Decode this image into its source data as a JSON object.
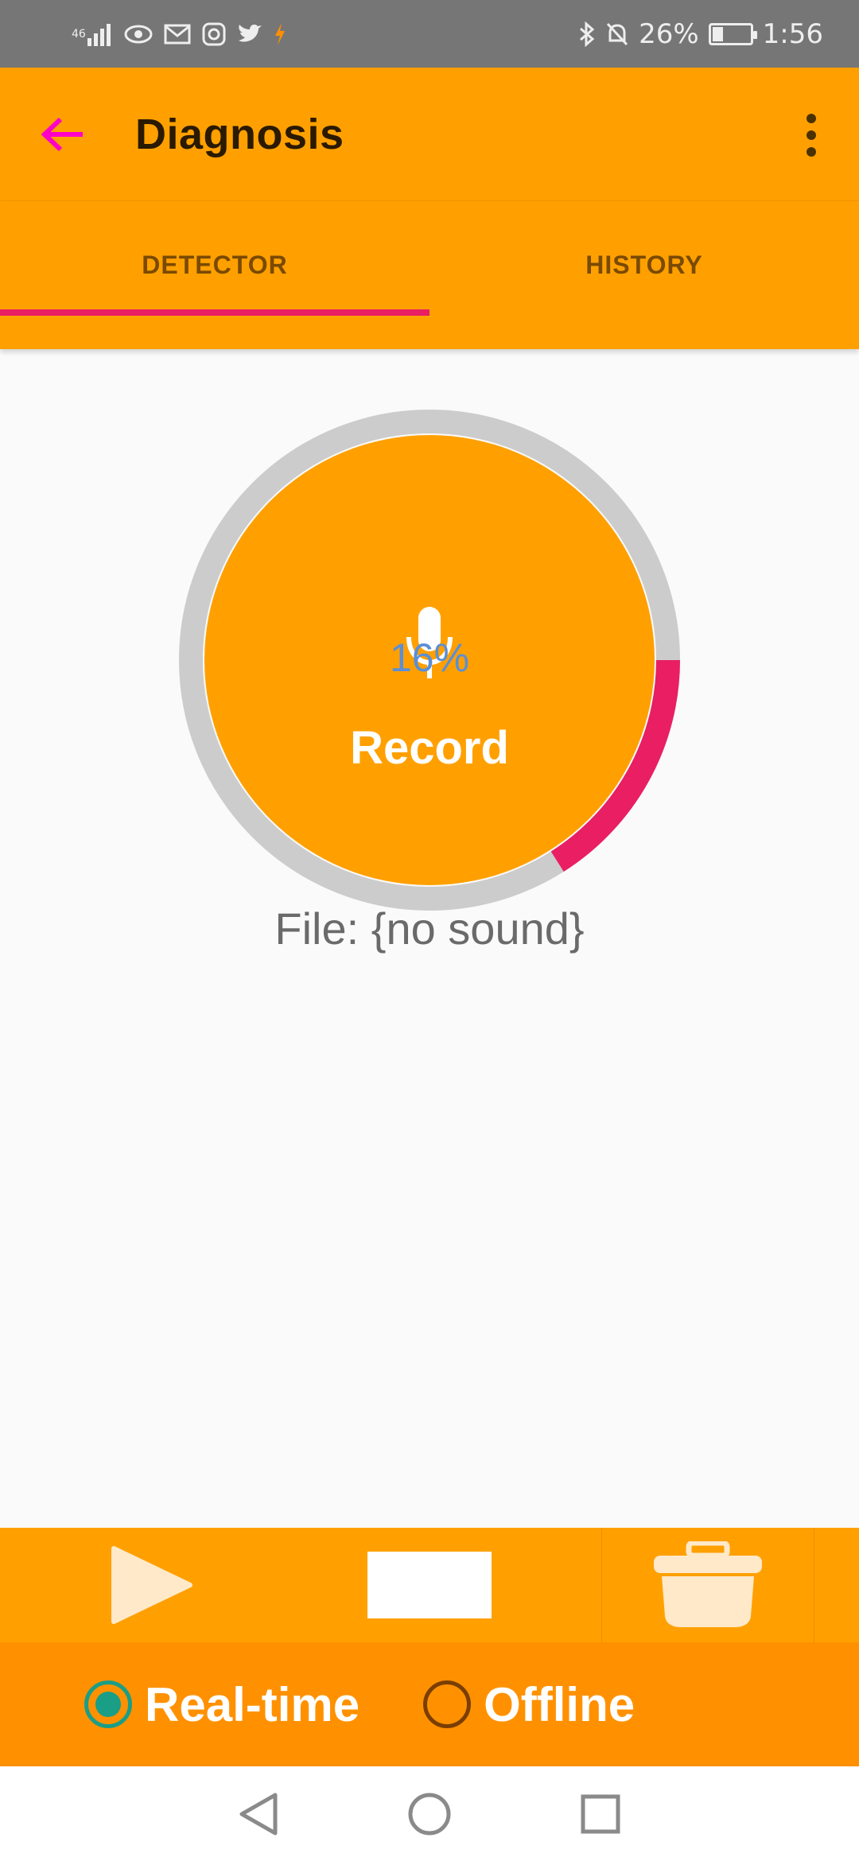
{
  "status_bar": {
    "network_label": "46",
    "battery_percent": "26%",
    "battery_level": 0.26,
    "time": "1:56",
    "left_icons": [
      "signal-icon",
      "eye-icon",
      "gmail-icon",
      "instagram-icon",
      "twitter-icon",
      "bolt-icon"
    ],
    "right_icons": [
      "bluetooth-icon",
      "bell-off-icon",
      "battery-icon"
    ]
  },
  "app_bar": {
    "title": "Diagnosis",
    "back_icon": "arrow-left-icon",
    "menu_icon": "more-vert-icon"
  },
  "tabs": [
    {
      "label": "DETECTOR",
      "selected": true
    },
    {
      "label": "HISTORY",
      "selected": false
    }
  ],
  "recorder": {
    "progress_percent": "16%",
    "progress_value": 0.16,
    "button_label": "Record",
    "icon": "microphone-icon",
    "file_label": "File: {no sound}"
  },
  "controls": {
    "play_icon": "play-icon",
    "stop_icon": "stop-icon",
    "delete_icon": "trash-icon"
  },
  "mode": {
    "options": [
      {
        "label": "Real-time",
        "selected": true
      },
      {
        "label": "Offline",
        "selected": false
      }
    ]
  },
  "nav": {
    "back_icon": "nav-back-icon",
    "home_icon": "nav-home-icon",
    "recents_icon": "nav-recents-icon"
  },
  "colors": {
    "accent": "#ffa000",
    "indicator": "#e91e63",
    "back_arrow": "#ff00c8",
    "radio_on": "#1a9e86",
    "percent_text": "#5b8fd6"
  }
}
